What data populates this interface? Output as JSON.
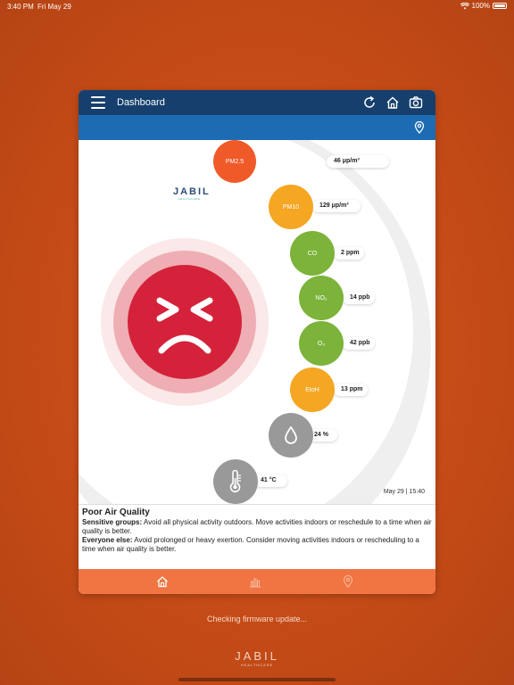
{
  "status": {
    "time": "3:40 PM",
    "date": "Fri May 29",
    "battery": "100%"
  },
  "header": {
    "title": "Dashboard"
  },
  "logo": {
    "main": "JABIL",
    "sub": "HEALTHCARE"
  },
  "sensors": [
    {
      "name": "PM2.5",
      "value": "46 μp/m³",
      "color": "#f05a28"
    },
    {
      "name": "PM10",
      "value": "129 μp/m³",
      "color": "#f5a623"
    },
    {
      "name": "CO",
      "value": "2 ppm",
      "color": "#7cb33a"
    },
    {
      "name": "NO₂",
      "value": "14 ppb",
      "color": "#7cb33a"
    },
    {
      "name": "O₃",
      "value": "42 ppb",
      "color": "#7cb33a"
    },
    {
      "name": "EtoH",
      "value": "13 ppm",
      "color": "#f5a623"
    },
    {
      "name": "humidity",
      "value": "24 %",
      "color": "#999999"
    },
    {
      "name": "temperature",
      "value": "41 °C",
      "color": "#999999"
    }
  ],
  "timestamp": "May 29 | 15:40",
  "info": {
    "title": "Poor Air Quality",
    "sensitive_label": "Sensitive groups:",
    "sensitive_text": " Avoid all physical activity outdoors. Move activities indoors or reschedule to a time when air quality is better.",
    "everyone_label": "Everyone else:",
    "everyone_text": " Avoid prolonged or heavy exertion. Consider moving activities indoors or rescheduling to a time when air quality is better."
  },
  "footer": {
    "firmware": "Checking firmware update...",
    "logo_main": "JABIL",
    "logo_sub": "HEALTHCARE"
  },
  "colors": {
    "background": "#c44b17",
    "header": "#163f6d",
    "subheader": "#1d6cb3",
    "bottom_nav": "#f07542",
    "face": "#d4223a"
  }
}
